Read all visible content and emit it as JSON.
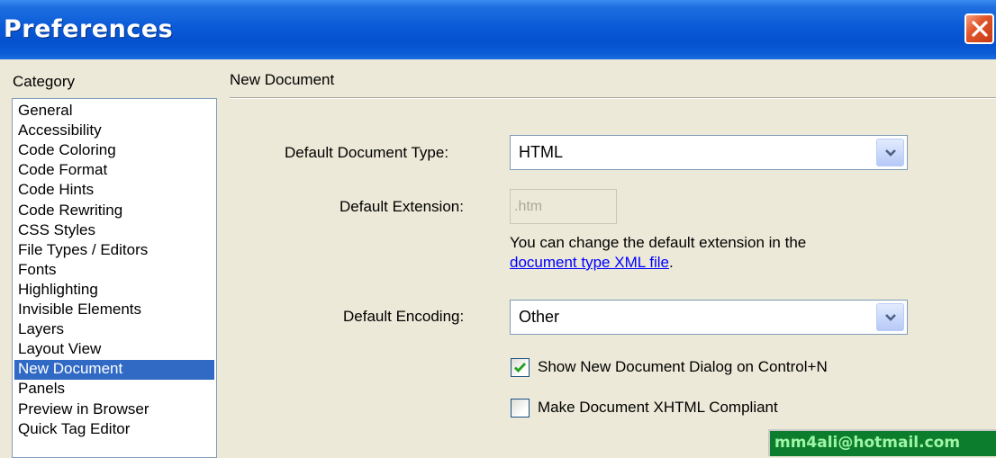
{
  "window": {
    "title": "Preferences"
  },
  "category": {
    "header": "Category",
    "items": [
      {
        "label": "General",
        "selected": false
      },
      {
        "label": "Accessibility",
        "selected": false
      },
      {
        "label": "Code Coloring",
        "selected": false
      },
      {
        "label": "Code Format",
        "selected": false
      },
      {
        "label": "Code Hints",
        "selected": false
      },
      {
        "label": "Code Rewriting",
        "selected": false
      },
      {
        "label": "CSS Styles",
        "selected": false
      },
      {
        "label": "File Types / Editors",
        "selected": false
      },
      {
        "label": "Fonts",
        "selected": false
      },
      {
        "label": "Highlighting",
        "selected": false
      },
      {
        "label": "Invisible Elements",
        "selected": false
      },
      {
        "label": "Layers",
        "selected": false
      },
      {
        "label": "Layout View",
        "selected": false
      },
      {
        "label": "New Document",
        "selected": true
      },
      {
        "label": "Panels",
        "selected": false
      },
      {
        "label": "Preview in Browser",
        "selected": false
      },
      {
        "label": "Quick Tag Editor",
        "selected": false
      }
    ]
  },
  "panel": {
    "title": "New Document",
    "default_document_type": {
      "label": "Default Document Type:",
      "value": "HTML"
    },
    "default_extension": {
      "label": "Default Extension:",
      "value": ".htm",
      "enabled": false
    },
    "hint": {
      "text_line1": "You can change the default extension in the",
      "link_text": "document type XML file",
      "after_link": "."
    },
    "default_encoding": {
      "label": "Default Encoding:",
      "value": "Other"
    },
    "show_new_doc_dialog": {
      "label": "Show New Document Dialog on Control+N",
      "checked": true
    },
    "xhtml_compliant": {
      "label": "Make Document XHTML Compliant",
      "checked": false
    }
  },
  "watermark": {
    "text": "mm4ali@hotmail.com"
  },
  "colors": {
    "titlebar": "#0552cf",
    "selection": "#316ac5",
    "dialog_bg": "#ece9d8",
    "link": "#0000ff",
    "watermark_bg": "#0b7d2c",
    "watermark_text": "#9ef5a6"
  }
}
